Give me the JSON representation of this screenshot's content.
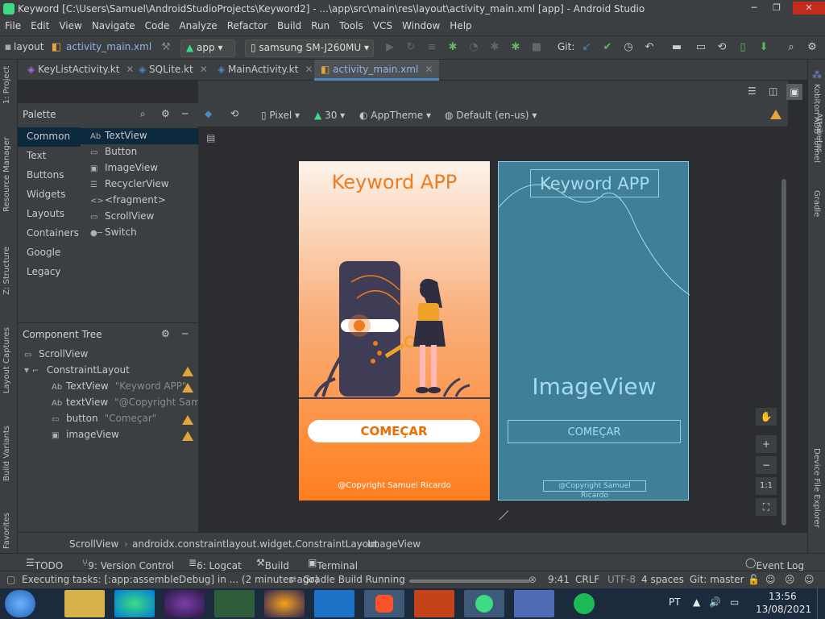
{
  "window": {
    "title": "Keyword [C:\\Users\\Samuel\\AndroidStudioProjects\\Keyword2] - ...\\app\\src\\main\\res\\layout\\activity_main.xml [app] - Android Studio"
  },
  "menu": [
    "File",
    "Edit",
    "View",
    "Navigate",
    "Code",
    "Analyze",
    "Refactor",
    "Build",
    "Run",
    "Tools",
    "VCS",
    "Window",
    "Help"
  ],
  "toolbar": {
    "breadcrumb_layout": "layout",
    "breadcrumb_file": "activity_main.xml",
    "module": "app",
    "device": "samsung SM-J260MU",
    "git_label": "Git:"
  },
  "left_tools": [
    "1: Project",
    "Resource Manager",
    "Z: Structure",
    "Layout Captures",
    "Build Variants",
    "Favorites"
  ],
  "right_tools": [
    "Kobiton ADB Tunnel",
    "Attributes",
    "Gradle",
    "Device File Explorer"
  ],
  "tabs": [
    {
      "label": "KeyListActivity.kt"
    },
    {
      "label": "SQLite.kt"
    },
    {
      "label": "MainActivity.kt"
    },
    {
      "label": "activity_main.xml"
    }
  ],
  "palette": {
    "title": "Palette",
    "categories": [
      "Common",
      "Text",
      "Buttons",
      "Widgets",
      "Layouts",
      "Containers",
      "Google",
      "Legacy"
    ],
    "items": [
      {
        "icon": "Ab",
        "label": "TextView"
      },
      {
        "icon": "▭",
        "label": "Button"
      },
      {
        "icon": "▣",
        "label": "ImageView"
      },
      {
        "icon": "☰",
        "label": "RecyclerView"
      },
      {
        "icon": "<>",
        "label": "<fragment>"
      },
      {
        "icon": "▭",
        "label": "ScrollView"
      },
      {
        "icon": "●─",
        "label": "Switch"
      }
    ]
  },
  "component_tree": {
    "title": "Component Tree",
    "rows": [
      {
        "icon": "▭",
        "label": "ScrollView",
        "sub": ""
      },
      {
        "icon": "⌐",
        "label": "ConstraintLayout",
        "sub": ""
      },
      {
        "icon": "Ab",
        "label": "TextView",
        "sub": "\"Keyword APP\""
      },
      {
        "icon": "Ab",
        "label": "textView",
        "sub": "\"@Copyright Sam..."
      },
      {
        "icon": "▭",
        "label": "button",
        "sub": "\"Começar\""
      },
      {
        "icon": "▣",
        "label": "imageView",
        "sub": ""
      }
    ]
  },
  "design_toolbar": {
    "device": "Pixel",
    "api": "30",
    "theme": "AppTheme",
    "locale": "Default (en-us)"
  },
  "design": {
    "title": "Keyword APP",
    "button": "COMEÇAR",
    "copyright": "@Copyright Samuel Ricardo"
  },
  "blueprint": {
    "title": "Keyword APP",
    "imageview": "ImageView",
    "button": "COMEÇAR",
    "copyright": "@Copyright Samuel Ricardo"
  },
  "zoom": {
    "fit": "1:1",
    "plus": "+",
    "minus": "−"
  },
  "breadcrumbs": [
    "ScrollView",
    "androidx.constraintlayout.widget.ConstraintLayout",
    "ImageView"
  ],
  "bottom_tools": [
    "TODO",
    "9: Version Control",
    "6: Logcat",
    "Build",
    "Terminal",
    "Event Log"
  ],
  "status": {
    "message": "Executing tasks: [:app:assembleDebug] in ... (2 minutes ago)",
    "gradle": "Gradle Build Running",
    "line": "9:41",
    "crlf": "CRLF",
    "encoding": "UTF-8",
    "indent": "4 spaces",
    "git": "Git: master"
  },
  "taskbar": {
    "lang": "PT",
    "time": "13:56",
    "date": "13/08/2021"
  }
}
